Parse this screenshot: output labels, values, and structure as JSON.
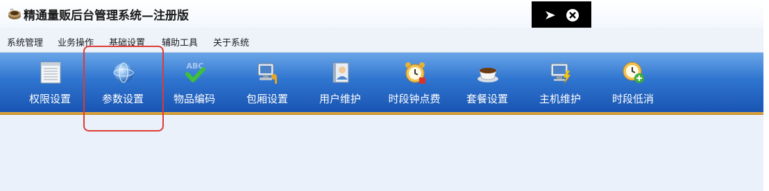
{
  "window": {
    "title": "精通量贩后台管理系统—注册版",
    "icon": "app-cup-icon"
  },
  "overlay": {
    "buttons": [
      {
        "name": "send-icon"
      },
      {
        "name": "close-circle-icon"
      }
    ]
  },
  "menu": {
    "items": [
      {
        "label": "系统管理"
      },
      {
        "label": "业务操作"
      },
      {
        "label": "基础设置"
      },
      {
        "label": "辅助工具"
      },
      {
        "label": "关于系统"
      }
    ]
  },
  "toolbar": {
    "items": [
      {
        "label": "权限设置",
        "icon": "list-document-icon"
      },
      {
        "label": "参数设置",
        "icon": "globe-icon"
      },
      {
        "label": "物品编码",
        "icon": "abc-check-icon"
      },
      {
        "label": "包厢设置",
        "icon": "computer-key-icon"
      },
      {
        "label": "用户维护",
        "icon": "user-book-icon"
      },
      {
        "label": "时段钟点费",
        "icon": "alarm-clock-icon"
      },
      {
        "label": "套餐设置",
        "icon": "coffee-cup-icon"
      },
      {
        "label": "主机维护",
        "icon": "monitor-lightning-icon"
      },
      {
        "label": "时段低消",
        "icon": "clock-add-icon"
      }
    ]
  },
  "colors": {
    "toolbar_top": "#6aa6e8",
    "toolbar_bottom": "#1a55b3",
    "highlight": "#e03a32",
    "content_bg": "#eaf1fb"
  },
  "annotation": {
    "highlighted_item": "参数设置"
  }
}
